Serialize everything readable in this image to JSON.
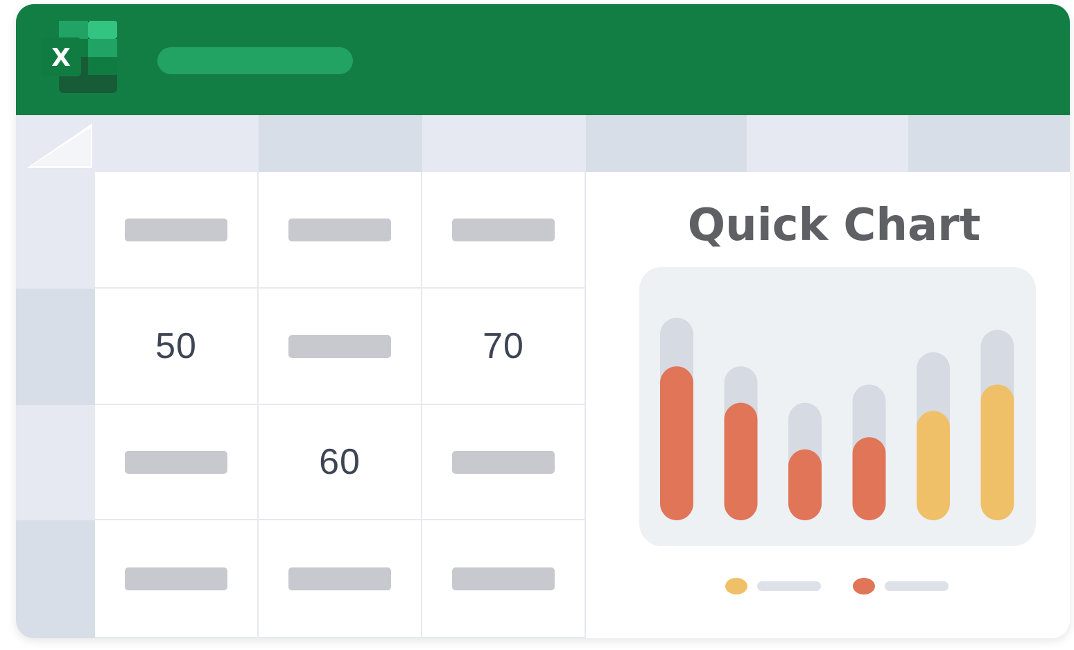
{
  "app": {
    "logo_letter": "X",
    "logo_icon": "excel-logo-icon",
    "colors": {
      "titlebar": "#137e44",
      "title_pill": "#22a263",
      "header_light": "#e6e9f1",
      "header_dark": "#d8dee7",
      "placeholder": "#c8c9ce",
      "bar_red": "#e07558",
      "bar_yellow": "#f0c069",
      "bar_track": "#d6dae2",
      "chart_bg": "#eef1f4"
    }
  },
  "grid": {
    "rows": [
      {
        "cells": [
          {
            "value": ""
          },
          {
            "value": ""
          },
          {
            "value": ""
          }
        ]
      },
      {
        "cells": [
          {
            "value": "50"
          },
          {
            "value": ""
          },
          {
            "value": "70"
          }
        ]
      },
      {
        "cells": [
          {
            "value": ""
          },
          {
            "value": "60"
          },
          {
            "value": ""
          }
        ]
      },
      {
        "cells": [
          {
            "value": ""
          },
          {
            "value": ""
          },
          {
            "value": ""
          }
        ]
      }
    ]
  },
  "chart": {
    "title": "Quick Chart"
  },
  "chart_data": {
    "type": "bar",
    "title": "Quick Chart",
    "xlabel": "",
    "ylabel": "",
    "ylim": [
      0,
      100
    ],
    "grid": false,
    "legend_placement": "bottom",
    "bars": [
      {
        "total": 100,
        "value": 76,
        "color": "#e07558"
      },
      {
        "total": 76,
        "value": 58,
        "color": "#e07558"
      },
      {
        "total": 58,
        "value": 35,
        "color": "#e07558"
      },
      {
        "total": 67,
        "value": 41,
        "color": "#e07558"
      },
      {
        "total": 83,
        "value": 54,
        "color": "#f0c069"
      },
      {
        "total": 94,
        "value": 67,
        "color": "#f0c069"
      }
    ],
    "legend": [
      {
        "color": "#f0c069"
      },
      {
        "color": "#e07558"
      }
    ]
  }
}
